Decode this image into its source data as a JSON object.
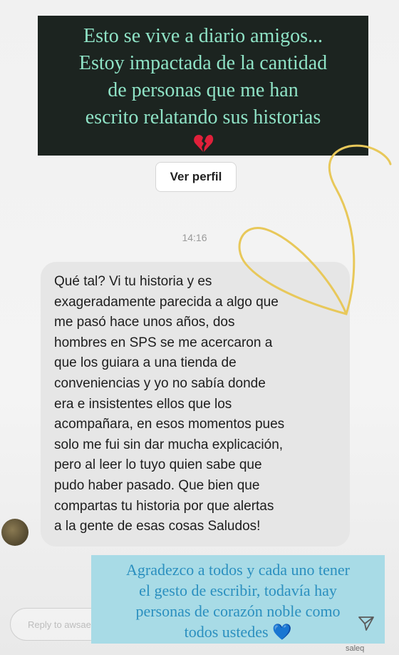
{
  "story": {
    "top_text_lines": [
      "Esto se vive a diario amigos...",
      "Estoy impactada de la cantidad",
      "de personas que me han",
      "escrito relatando sus historias"
    ],
    "top_emoji": "broken-heart-icon",
    "view_profile_label": "Ver perfil",
    "timestamp": "14:16",
    "message_lines": [
      "Qué tal? Vi tu historia y es",
      "exageradamente parecida a algo que",
      "me pasó hace unos años, dos",
      "hombres en SPS se me acercaron a",
      "que los guiara a una tienda de",
      "conveniencias y yo no sabía donde",
      "era e insistentes ellos que los",
      "acompañara, en esos momentos pues",
      "solo me fui sin dar mucha explicación,",
      "pero al leer lo tuyo quien sabe que",
      "pudo haber pasado. Que bien que",
      "compartas tu historia por que alertas",
      "a la gente de esas cosas Saludos!"
    ],
    "bottom_text_lines": [
      "Agradezco a todos y cada uno tener",
      "el gesto de escribir, todavía hay",
      "personas de corazón noble como",
      "todos ustedes 💙"
    ],
    "reply_placeholder": "Reply to awsaed1516...",
    "watermark": "saleq",
    "colors": {
      "top_banner_bg": "#1c2420",
      "top_text": "#8fe3c6",
      "bottom_banner_bg": "#a8dbe6",
      "bottom_text": "#2a8fbf",
      "gold_heart": "#e8c85a"
    }
  }
}
